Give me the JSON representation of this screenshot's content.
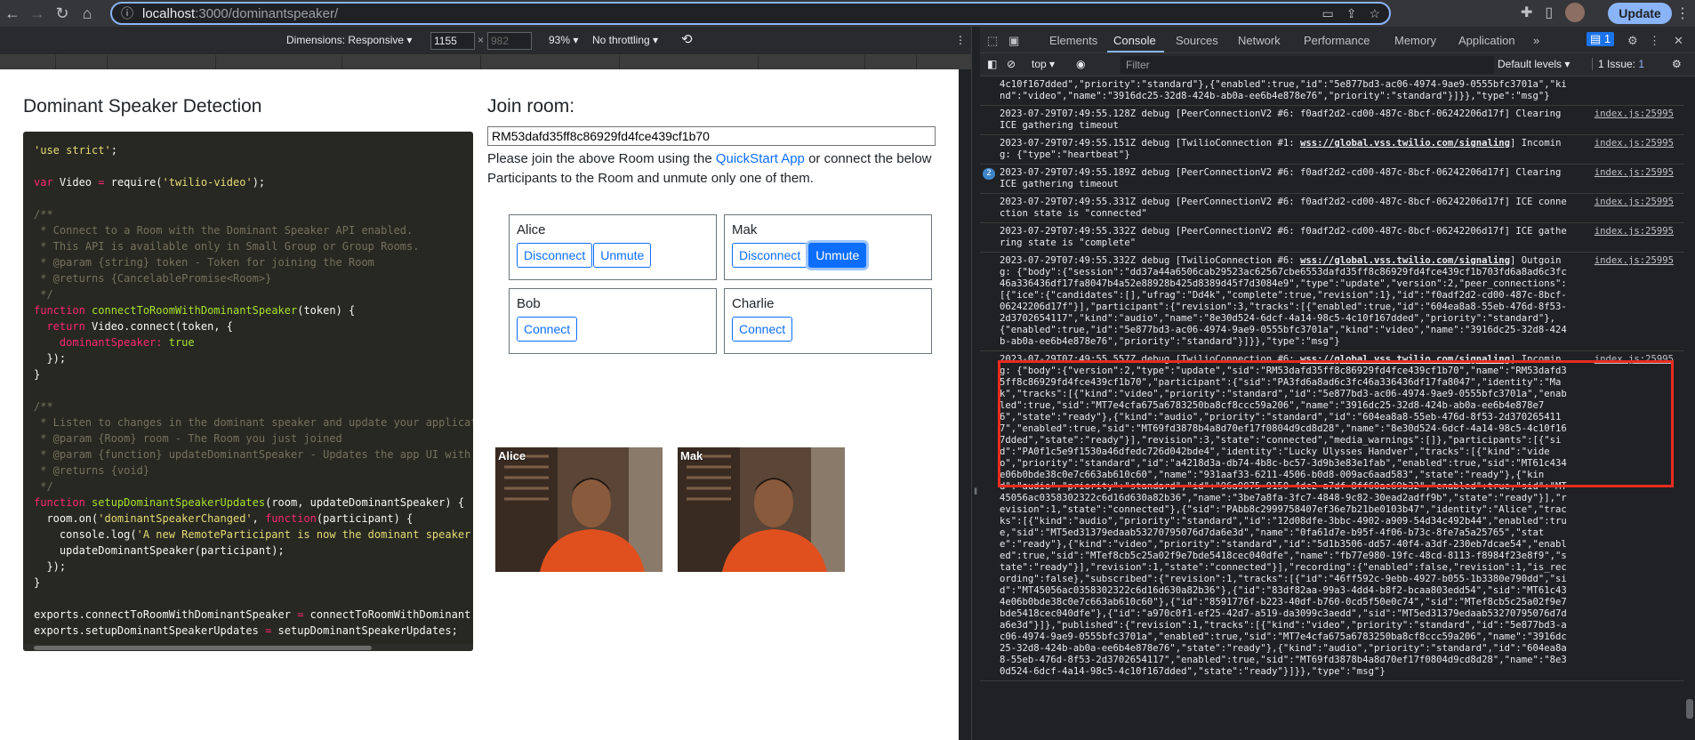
{
  "browser": {
    "url_host": "localhost",
    "url_path": ":3000/dominantspeaker/",
    "update_label": "Update"
  },
  "device_toolbar": {
    "dimensions_label": "Dimensions: Responsive",
    "width_value": "1155",
    "height_value": "982",
    "times": "×",
    "zoom": "93%",
    "throttling": "No throttling"
  },
  "page": {
    "title": "Dominant Speaker Detection",
    "code_lines": [
      [
        {
          "t": "'use strict'",
          "c": "str"
        },
        {
          "t": ";",
          "c": ""
        }
      ],
      [],
      [
        {
          "t": "var",
          "c": "kw"
        },
        {
          "t": " Video ",
          "c": ""
        },
        {
          "t": "=",
          "c": "kw"
        },
        {
          "t": " require(",
          "c": ""
        },
        {
          "t": "'twilio-video'",
          "c": "str"
        },
        {
          "t": ");",
          "c": ""
        }
      ],
      [],
      [
        {
          "t": "/**",
          "c": "cm"
        }
      ],
      [
        {
          "t": " * Connect to a Room with the Dominant Speaker API enabled.",
          "c": "cm"
        }
      ],
      [
        {
          "t": " * This API is available only in Small Group or Group Rooms.",
          "c": "cm"
        }
      ],
      [
        {
          "t": " * @param {string} token - Token for joining the Room",
          "c": "cm"
        }
      ],
      [
        {
          "t": " * @returns {CancelablePromise<Room>}",
          "c": "cm"
        }
      ],
      [
        {
          "t": " */",
          "c": "cm"
        }
      ],
      [
        {
          "t": "function",
          "c": "kw"
        },
        {
          "t": " ",
          "c": ""
        },
        {
          "t": "connectToRoomWithDominantSpeaker",
          "c": "fn"
        },
        {
          "t": "(token) {",
          "c": ""
        }
      ],
      [
        {
          "t": "  ",
          "c": ""
        },
        {
          "t": "return",
          "c": "kw"
        },
        {
          "t": " Video.connect(token, {",
          "c": ""
        }
      ],
      [
        {
          "t": "    dominantSpeaker: ",
          "c": "kw"
        },
        {
          "t": "true",
          "c": "fn"
        }
      ],
      [
        {
          "t": "  });",
          "c": ""
        }
      ],
      [
        {
          "t": "}",
          "c": ""
        }
      ],
      [],
      [
        {
          "t": "/**",
          "c": "cm"
        }
      ],
      [
        {
          "t": " * Listen to changes in the dominant speaker and update your applicat",
          "c": "cm"
        }
      ],
      [
        {
          "t": " * @param {Room} room - The Room you just joined",
          "c": "cm"
        }
      ],
      [
        {
          "t": " * @param {function} updateDominantSpeaker - Updates the app UI with",
          "c": "cm"
        }
      ],
      [
        {
          "t": " * @returns {void}",
          "c": "cm"
        }
      ],
      [
        {
          "t": " */",
          "c": "cm"
        }
      ],
      [
        {
          "t": "function",
          "c": "kw"
        },
        {
          "t": " ",
          "c": ""
        },
        {
          "t": "setupDominantSpeakerUpdates",
          "c": "fn"
        },
        {
          "t": "(room, updateDominantSpeaker) {",
          "c": ""
        }
      ],
      [
        {
          "t": "  room.on(",
          "c": ""
        },
        {
          "t": "'dominantSpeakerChanged'",
          "c": "str"
        },
        {
          "t": ", ",
          "c": ""
        },
        {
          "t": "function",
          "c": "kw"
        },
        {
          "t": "(participant) {",
          "c": ""
        }
      ],
      [
        {
          "t": "    console.log(",
          "c": ""
        },
        {
          "t": "'A new RemoteParticipant is now the dominant speaker",
          "c": "str"
        }
      ],
      [
        {
          "t": "    updateDominantSpeaker(participant);",
          "c": ""
        }
      ],
      [
        {
          "t": "  });",
          "c": ""
        }
      ],
      [
        {
          "t": "}",
          "c": ""
        }
      ],
      [],
      [
        {
          "t": "exports.connectToRoomWithDominantSpeaker ",
          "c": ""
        },
        {
          "t": "=",
          "c": "kw"
        },
        {
          "t": " connectToRoomWithDominant",
          "c": ""
        }
      ],
      [
        {
          "t": "exports.setupDominantSpeakerUpdates ",
          "c": ""
        },
        {
          "t": "=",
          "c": "kw"
        },
        {
          "t": " setupDominantSpeakerUpdates;",
          "c": ""
        }
      ]
    ],
    "join_title": "Join room:",
    "room_sid": "RM53dafd35ff8c86929fd4fce439cf1b70",
    "instr_before": "Please join the above Room using the ",
    "instr_link": "QuickStart App",
    "instr_after": " or connect the below Participants to the Room and unmute only one of them.",
    "participants": [
      {
        "name": "Alice",
        "btn1": "Disconnect",
        "btn2": "Unmute"
      },
      {
        "name": "Mak",
        "btn1": "Disconnect",
        "btn2": "Unmute"
      },
      {
        "name": "Bob",
        "btn1": "Connect"
      },
      {
        "name": "Charlie",
        "btn1": "Connect"
      }
    ],
    "videos": [
      "Alice",
      "Mak"
    ]
  },
  "devtools": {
    "tabs": [
      "Elements",
      "Console",
      "Sources",
      "Network",
      "Performance",
      "Memory",
      "Application"
    ],
    "selected_tab": "Console",
    "messages_badge": "1",
    "context": "top",
    "filter_placeholder": "Filter",
    "levels": "Default levels ▾",
    "issues": "1 Issue: ",
    "issues_count": "1",
    "console_messages": [
      {
        "text": "4c10f167dded\",\"priority\":\"standard\"},{\"enabled\":true,\"id\":\"5e877bd3-ac06-4974-9ae9-0555bfc3701a\",\"kind\":\"video\",\"name\":\"3916dc25-32d8-424b-ab0a-ee6b4e878e76\",\"priority\":\"standard\"}]}},\"type\":\"msg\"}",
        "src": ""
      },
      {
        "text": "2023-07-29T07:49:55.128Z debug [PeerConnectionV2 #6: f0adf2d2-cd00-487c-8bcf-06242206d17f] Clearing ICE gathering timeout",
        "src": "index.js:25995"
      },
      {
        "text": "2023-07-29T07:49:55.151Z debug [TwilioConnection #1: ",
        "url": "wss://global.vss.twilio.com/signaling",
        "after": "] Incoming: {\"type\":\"heartbeat\"}",
        "src": "index.js:25995"
      },
      {
        "text": "2023-07-29T07:49:55.189Z debug [PeerConnectionV2 #6: f0adf2d2-cd00-487c-8bcf-06242206d17f] Clearing ICE gathering timeout",
        "src": "index.js:25995",
        "count": "2"
      },
      {
        "text": "2023-07-29T07:49:55.331Z debug [PeerConnectionV2 #6: f0adf2d2-cd00-487c-8bcf-06242206d17f] ICE connection state is \"connected\"",
        "src": "index.js:25995"
      },
      {
        "text": "2023-07-29T07:49:55.332Z debug [PeerConnectionV2 #6: f0adf2d2-cd00-487c-8bcf-06242206d17f] ICE gathering state is \"complete\"",
        "src": "index.js:25995"
      },
      {
        "text": "2023-07-29T07:49:55.332Z debug [TwilioConnection #6: ",
        "url": "wss://global.vss.twilio.com/signaling",
        "after": "] Outgoing: {\"body\":{\"session\":\"dd37a44a6506cab29523ac62567cbe6553dafd35ff8c86929fd4fce439cf1b703fd6a8ad6c3fc46a336436df17fa8047b4a52e88928b425d8389d45f7d3084e9\",\"type\":\"update\",\"version\":2,\"peer_connections\":[{\"ice\":{\"candidates\":[],\"ufrag\":\"Dd4k\",\"complete\":true,\"revision\":1},\"id\":\"f0adf2d2-cd00-487c-8bcf-06242206d17f\"}],\"participant\":{\"revision\":3,\"tracks\":[{\"enabled\":true,\"id\":\"604ea8a8-55eb-476d-8f53-2d3702654117\",\"kind\":\"audio\",\"name\":\"8e30d524-6dcf-4a14-98c5-4c10f167dded\",\"priority\":\"standard\"},{\"enabled\":true,\"id\":\"5e877bd3-ac06-4974-9ae9-0555bfc3701a\",\"kind\":\"video\",\"name\":\"3916dc25-32d8-424b-ab0a-ee6b4e878e76\",\"priority\":\"standard\"}]}},\"type\":\"msg\"}",
        "src": "index.js:25995"
      },
      {
        "text": "2023-07-29T07:49:55.557Z debug [TwilioConnection #6: ",
        "url": "wss://global.vss.twilio.com/signaling",
        "after": "] Incoming: {\"body\":{\"version\":2,\"type\":\"update\",\"sid\":\"RM53dafd35ff8c86929fd4fce439cf1b70\",\"name\":\"RM53dafd35ff8c86929fd4fce439cf1b70\",\"participant\":{\"sid\":\"PA3fd6a8ad6c3fc46a336436df17fa8047\",\"identity\":\"Mak\",\"tracks\":[{\"kind\":\"video\",\"priority\":\"standard\",\"id\":\"5e877bd3-ac06-4974-9ae9-0555bfc3701a\",\"enabled\":true,\"sid\":\"MT7e4cfa675a6783250ba8cf8ccc59a206\",\"name\":\"3916dc25-32d8-424b-ab0a-ee6b4e878e76\",\"state\":\"ready\"},{\"kind\":\"audio\",\"priority\":\"standard\",\"id\":\"604ea8a8-55eb-476d-8f53-2d3702654117\",\"enabled\":true,\"sid\":\"MT69fd3878b4a8d70ef17f0804d9cd8d28\",\"name\":\"8e30d524-6dcf-4a14-98c5-4c10f167dded\",\"state\":\"ready\"}],\"revision\":3,\"state\":\"connected\",\"media_warnings\":[]},\"participants\":[{\"sid\":\"PA0f1c5e9f1530a46dfedc726d042bde4\",\"identity\":\"Lucky Ulysses Handver\",\"tracks\":[{\"kind\":\"video\",\"priority\":\"standard\",\"id\":\"a4218d3a-db74-4b8c-bc57-3d9b3e83e1fab\",\"enabled\":true,\"sid\":\"MT61c434e06b0bde38c0e7c663ab610c60\",\"name\":\"931aaf33-6211-4506-b0d8-009ac6aad583\",\"state\":\"ready\"},{\"kind\":\"audio\",\"priority\":\"standard\",\"id\":\"96a9075-9150-4dc2-a7df-8ff60ae69b32\",\"enabled\":true,\"sid\":\"MT45056ac0358302322c6d16d630a82b36\",\"name\":\"3be7a8fa-3fc7-4848-9c82-30ead2adff9b\",\"state\":\"ready\"}],\"revision\":1,\"state\":\"connected\"},{\"sid\":\"PAbb8c2999758407ef36e7b21be0103b47\",\"identity\":\"Alice\",\"tracks\":[{\"kind\":\"audio\",\"priority\":\"standard\",\"id\":\"12d08dfe-3bbc-4902-a909-54d34c492b44\",\"enabled\":true,\"sid\":\"MT5ed31379edaab53270795076d7da6e3d\",\"name\":\"0fa61d7e-b95f-4f06-b73c-8fe7a5a25765\",\"state\":\"ready\"},{\"kind\":\"video\",\"priority\":\"standard\",\"id\":\"5d1b3506-dd57-40f4-a3df-230eb7dcae54\",\"enabled\":true,\"sid\":\"MTef8cb5c25a02f9e7bde5418cec040dfe\",\"name\":\"fb77e980-19fc-48cd-8113-f8984f23e8f9\",\"state\":\"ready\"}],\"revision\":1,\"state\":\"connected\"}],\"recording\":{\"enabled\":false,\"revision\":1,\"is_recording\":false},\"subscribed\":{\"revision\":1,\"tracks\":[{\"id\":\"46ff592c-9ebb-4927-b055-1b3380e790dd\",\"sid\":\"MT45056ac0358302322c6d16d630a82b36\"},{\"id\":\"83df82aa-99a3-4dd4-b8f2-bcaa803edd54\",\"sid\":\"MT61c434e06b0bde38c0e7c663ab610c60\"},{\"id\":\"8591776f-b223-40df-b760-0cd5f50e0c74\",\"sid\":\"MTef8cb5c25a02f9e7bde5418cec040dfe\"},{\"id\":\"a970c0f1-ef25-42d7-a519-da3099c3aedd\",\"sid\":\"MT5ed31379edaab53270795076d7da6e3d\"}]},\"published\":{\"revision\":1,\"tracks\":[{\"kind\":\"video\",\"priority\":\"standard\",\"id\":\"5e877bd3-ac06-4974-9ae9-0555bfc3701a\",\"enabled\":true,\"sid\":\"MT7e4cfa675a6783250ba8cf8ccc59a206\",\"name\":\"3916dc25-32d8-424b-ab0a-ee6b4e878e76\",\"state\":\"ready\"},{\"kind\":\"audio\",\"priority\":\"standard\",\"id\":\"604ea8a8-55eb-476d-8f53-2d3702654117\",\"enabled\":true,\"sid\":\"MT69fd3878b4a8d70ef17f0804d9cd8d28\",\"name\":\"8e30d524-6dcf-4a14-98c5-4c10f167dded\",\"state\":\"ready\"}]}},\"type\":\"msg\"}",
        "src": "index.js:25995"
      }
    ]
  },
  "colors": {
    "highlight": "#e62c1f",
    "accent": "#0d6efd"
  }
}
